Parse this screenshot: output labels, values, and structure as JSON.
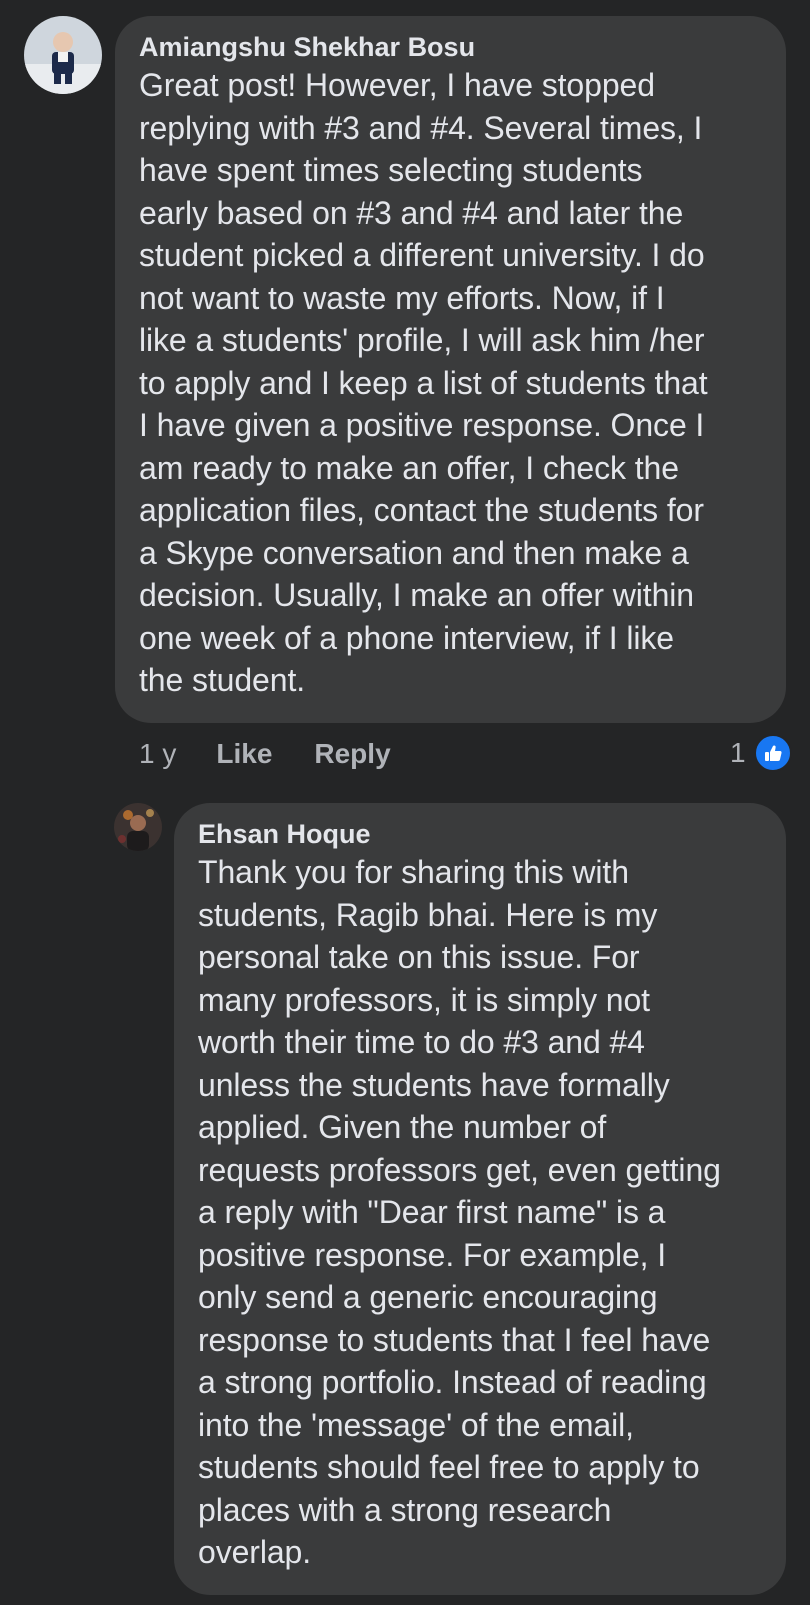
{
  "comments": [
    {
      "author": "Amiangshu Shekhar Bosu",
      "text": "Great post! However, I have stopped\nreplying with #3 and #4. Several times, I\nhave spent times selecting students\nearly based on #3 and #4 and later the\nstudent picked a different university. I do\nnot want to waste my efforts. Now, if I\nlike a students' profile, I will ask him /her\nto apply and I keep a list of students that\nI have given a positive response. Once I\nam ready to make an offer, I check the\napplication files, contact the students for\na Skype conversation and then make a\ndecision. Usually, I make an offer within\none week of a phone interview, if I like\nthe student.",
      "age": "1 y",
      "like_label": "Like",
      "reply_label": "Reply",
      "reaction_count": "1",
      "reaction_icon": "thumbs-up-icon",
      "reaction_color": "#1877f2"
    },
    {
      "author": "Ehsan Hoque",
      "text": "Thank you for sharing this with\nstudents, Ragib bhai. Here is my\npersonal take on this issue. For\nmany professors, it is simply not\nworth their time to do #3 and #4\nunless the students have formally\napplied. Given the number of\nrequests professors get, even getting\na reply with \"Dear first name\" is a\npositive response. For example, I\nonly send a generic encouraging\nresponse to students that I feel have\na strong portfolio. Instead of reading\ninto the 'message' of the email,\nstudents should feel free to apply to\nplaces with a strong research\noverlap."
    }
  ],
  "theme": {
    "background": "#242526",
    "bubble": "#3a3b3c",
    "text": "#e4e6eb",
    "muted": "#b0b3b8"
  }
}
